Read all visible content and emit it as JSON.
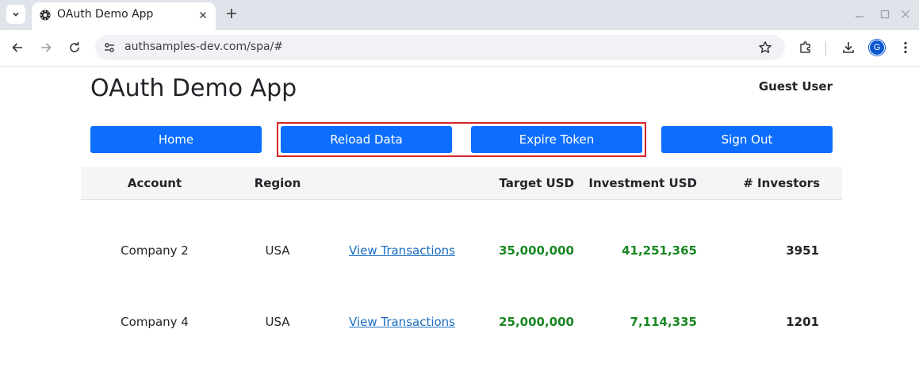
{
  "browser": {
    "tab": {
      "title": "OAuth Demo App"
    },
    "address_bar": {
      "url": "authsamples-dev.com/spa/#"
    },
    "profile_initial": "G"
  },
  "app": {
    "title": "OAuth Demo App",
    "user": "Guest User"
  },
  "buttons": {
    "home": "Home",
    "reload": "Reload Data",
    "expire": "Expire Token",
    "signout": "Sign Out"
  },
  "table": {
    "headers": {
      "account": "Account",
      "region": "Region",
      "target": "Target USD",
      "investment": "Investment USD",
      "investors": "# Investors"
    },
    "rows": [
      {
        "account": "Company 2",
        "region": "USA",
        "link": "View Transactions",
        "target": "35,000,000",
        "investment": "41,251,365",
        "investors": "3951"
      },
      {
        "account": "Company 4",
        "region": "USA",
        "link": "View Transactions",
        "target": "25,000,000",
        "investment": "7,114,335",
        "investors": "1201"
      }
    ]
  },
  "colors": {
    "primary_button": "#0d6efd",
    "money_green": "#198722",
    "link_blue": "#1a6ec1",
    "highlight_red": "#d6242b"
  }
}
